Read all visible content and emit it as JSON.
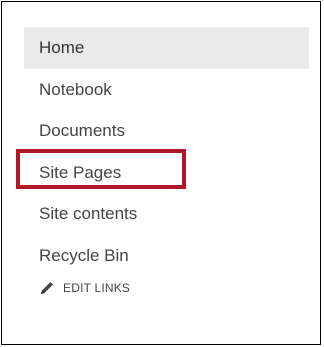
{
  "nav": {
    "items": [
      {
        "label": "Home",
        "selected": true
      },
      {
        "label": "Notebook"
      },
      {
        "label": "Documents"
      },
      {
        "label": "Site Pages",
        "highlighted": true
      },
      {
        "label": "Site contents"
      },
      {
        "label": "Recycle Bin"
      }
    ]
  },
  "edit_links": {
    "icon": "pencil-icon",
    "label": "EDIT LINKS"
  },
  "colors": {
    "highlight_border": "#b0182a",
    "selected_background": "#eaeaea",
    "text": "#444444"
  }
}
